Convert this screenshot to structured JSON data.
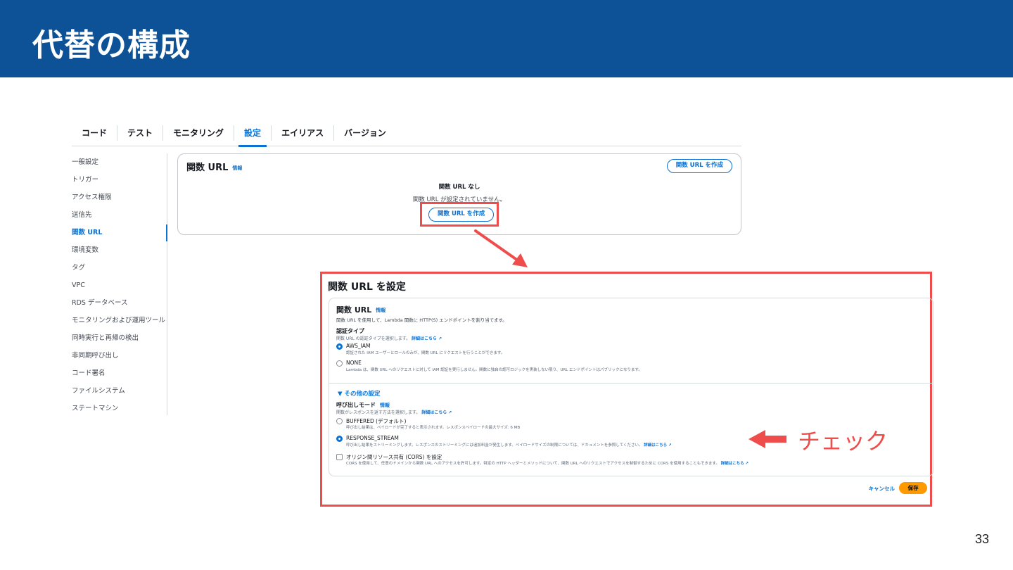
{
  "slide": {
    "title": "代替の構成",
    "page_number": "33"
  },
  "console": {
    "tabs": [
      "コード",
      "テスト",
      "モニタリング",
      "設定",
      "エイリアス",
      "バージョン"
    ],
    "active_tab": "設定",
    "side_nav": [
      "一般設定",
      "トリガー",
      "アクセス権限",
      "送信先",
      "関数 URL",
      "環境変数",
      "タグ",
      "VPC",
      "RDS データベース",
      "モニタリングおよび運用ツール",
      "同時実行と再帰の検出",
      "非同期呼び出し",
      "コード署名",
      "ファイルシステム",
      "ステートマシン"
    ],
    "active_nav": "関数 URL",
    "function_url_card": {
      "title": "関数 URL",
      "info": "情報",
      "create_button": "関数 URL を作成",
      "empty_title": "関数 URL なし",
      "empty_desc": "関数 URL が設定されていません。",
      "create_button_center": "関数 URL を作成"
    }
  },
  "config_dialog": {
    "title": "関数 URL を設定",
    "section_title": "関数 URL",
    "info": "情報",
    "section_desc": "関数 URL を使用して、Lambda 関数に HTTP(S) エンドポイントを割り当てます。",
    "auth_type": {
      "title": "認証タイプ",
      "desc": "関数 URL の認証タイプを選択します。",
      "link": "詳細はこちら",
      "options": [
        {
          "label": "AWS_IAM",
          "desc": "認証された IAM ユーザーとロールのみが、関数 URL にリクエストを行うことができます。",
          "selected": true
        },
        {
          "label": "NONE",
          "desc": "Lambda は、関数 URL へのリクエストに対して IAM 認証を実行しません。関数に独自の認可ロジックを実装しない限り、URL エンドポイントはパブリックになります。",
          "selected": false
        }
      ]
    },
    "other_settings": "▼ その他の設定",
    "invoke_mode": {
      "title": "呼び出しモード",
      "info": "情報",
      "desc": "関数がレスポンスを返す方法を選択します。",
      "link": "詳細はこちら",
      "options": [
        {
          "label": "BUFFERED (デフォルト)",
          "desc": "呼び出し結果は、ペイロードが完了すると表示されます。レスポンスペイロードの最大サイズ: 6 MB",
          "selected": false
        },
        {
          "label": "RESPONSE_STREAM",
          "desc": "呼び出し結果をストリーミングします。レスポンスのストリーミングには追加料金が発生します。ペイロードサイズの制限については、ドキュメントを参照してください。",
          "link": "詳細はこちら",
          "selected": true
        }
      ]
    },
    "cors": {
      "label": "オリジン間リソース共有 (CORS) を設定",
      "desc": "CORS を使用して、任意のドメインから関数 URL へのアクセスを許可します。特定の HTTP ヘッダーとメソッドについて、関数 URL へのリクエストでアクセスを制御するために CORS を使用することもできます。",
      "link": "詳細はこちら",
      "checked": false
    },
    "cancel": "キャンセル",
    "save": "保存"
  },
  "annotation": {
    "label": "チェック"
  },
  "colors": {
    "header": "#0d5296",
    "highlight": "#ef4c4c",
    "link": "#0972d3",
    "primary_button": "#ff9900"
  }
}
